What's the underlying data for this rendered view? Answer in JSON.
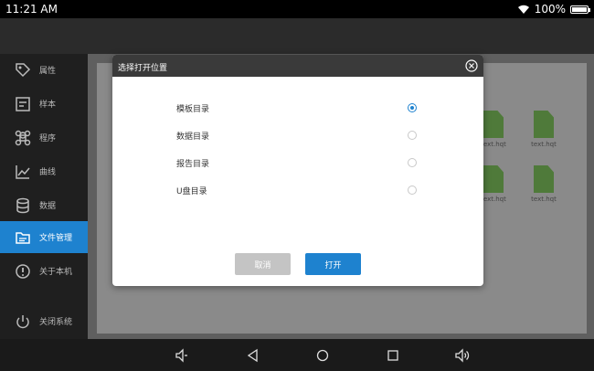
{
  "status": {
    "time": "11:21 AM",
    "battery": "100%",
    "battery_level": 1.0
  },
  "sidebar": {
    "items": [
      {
        "label": "属性",
        "icon": "tag-icon"
      },
      {
        "label": "样本",
        "icon": "sample-icon"
      },
      {
        "label": "程序",
        "icon": "command-icon"
      },
      {
        "label": "曲线",
        "icon": "chart-line-icon"
      },
      {
        "label": "数据",
        "icon": "database-icon"
      },
      {
        "label": "文件管理",
        "icon": "folder-icon",
        "active": true
      },
      {
        "label": "关于本机",
        "icon": "info-icon"
      },
      {
        "label": "关闭系统",
        "icon": "power-icon"
      }
    ]
  },
  "files": [
    "text.hqt",
    "text.hqt",
    "text.hqt",
    "text.hqt"
  ],
  "dialog": {
    "title": "选择打开位置",
    "options": [
      {
        "label": "模板目录",
        "selected": true
      },
      {
        "label": "数据目录",
        "selected": false
      },
      {
        "label": "报告目录",
        "selected": false
      },
      {
        "label": "U盘目录",
        "selected": false
      }
    ],
    "cancel_label": "取消",
    "open_label": "打开"
  },
  "colors": {
    "accent": "#1e82cf",
    "dialog_header": "#3a3a3a",
    "cancel_button": "#c4c4c4"
  }
}
